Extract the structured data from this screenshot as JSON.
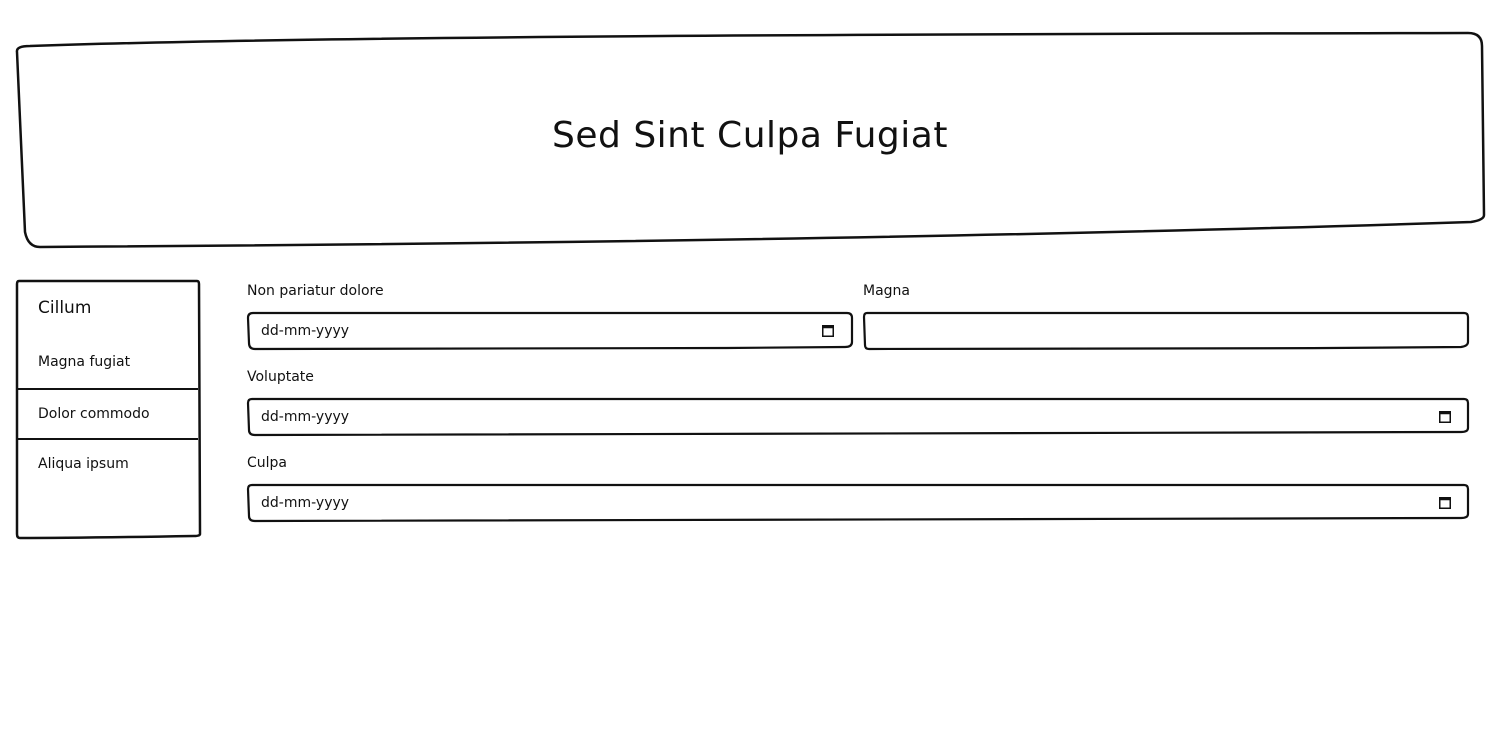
{
  "header": {
    "title": "Sed Sint Culpa Fugiat"
  },
  "sidebar": {
    "heading": "Cillum",
    "items": [
      {
        "label": "Magna fugiat"
      },
      {
        "label": "Dolor commodo"
      },
      {
        "label": "Aliqua ipsum"
      }
    ]
  },
  "form": {
    "fields": [
      {
        "label": "Non pariatur dolore",
        "type": "date",
        "value": "dd-mm-yyyy"
      },
      {
        "label": "Magna",
        "type": "text",
        "value": ""
      },
      {
        "label": "Voluptate",
        "type": "date",
        "value": "dd-mm-yyyy"
      },
      {
        "label": "Culpa",
        "type": "date",
        "value": "dd-mm-yyyy"
      }
    ]
  },
  "icons": {
    "date_picker": "calendar-icon"
  },
  "colors": {
    "ink": "#111111",
    "background": "#ffffff"
  }
}
